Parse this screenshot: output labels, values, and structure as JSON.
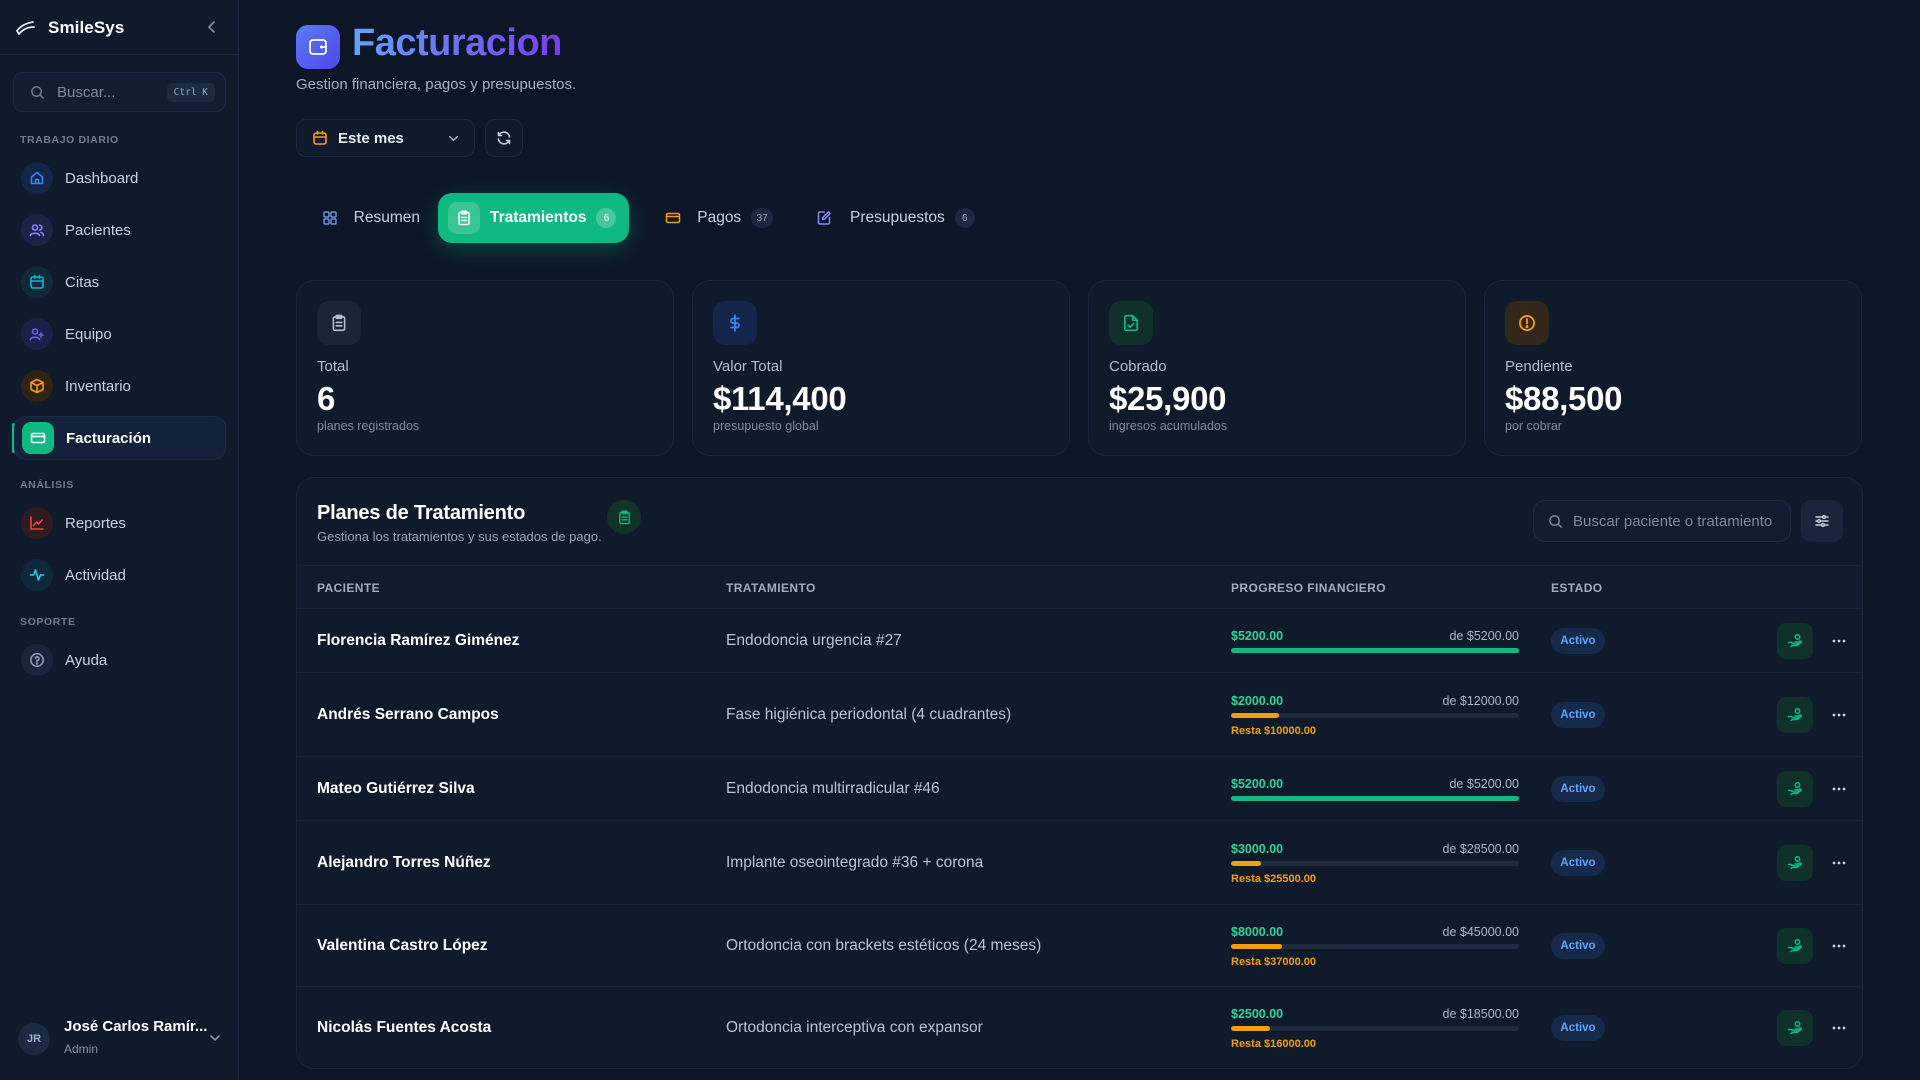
{
  "app": {
    "name": "SmileSys"
  },
  "sidebar": {
    "search_placeholder": "Buscar...",
    "search_shortcut": "Ctrl K",
    "sections": {
      "daily": "TRABAJO DIARIO",
      "analysis": "ANÁLISIS",
      "support": "SOPORTE"
    },
    "items": [
      {
        "label": "Dashboard",
        "icon": "home-icon",
        "color": "#3b82f6"
      },
      {
        "label": "Pacientes",
        "icon": "users-icon",
        "color": "#818cf8"
      },
      {
        "label": "Citas",
        "icon": "calendar-icon",
        "color": "#06b6d4"
      },
      {
        "label": "Equipo",
        "icon": "team-icon",
        "color": "#6366f1"
      },
      {
        "label": "Inventario",
        "icon": "box-icon",
        "color": "#f59e0b"
      },
      {
        "label": "Facturación",
        "icon": "billing-icon",
        "color": "#10b981",
        "active": true
      },
      {
        "label": "Reportes",
        "icon": "chart-icon",
        "color": "#ef4444"
      },
      {
        "label": "Actividad",
        "icon": "activity-icon",
        "color": "#22d3ee"
      },
      {
        "label": "Ayuda",
        "icon": "help-icon",
        "color": "#94a3b8"
      }
    ],
    "user": {
      "initials": "JR",
      "name": "José Carlos Ramír...",
      "role": "Admin"
    }
  },
  "header": {
    "title": "Facturacion",
    "subtitle": "Gestion financiera, pagos y presupuestos.",
    "period": "Este mes"
  },
  "tabs": [
    {
      "label": "Resumen",
      "badge": null,
      "icon": "grid-icon"
    },
    {
      "label": "Tratamientos",
      "badge": "6",
      "icon": "clipboard-icon",
      "active": true
    },
    {
      "label": "Pagos",
      "badge": "37",
      "icon": "card-icon"
    },
    {
      "label": "Presupuestos",
      "badge": "6",
      "icon": "edit-doc-icon"
    }
  ],
  "stats": [
    {
      "label": "Total",
      "value": "6",
      "help": "planes registrados",
      "icon": "clipboard-icon",
      "color": "#94a3b8"
    },
    {
      "label": "Valor Total",
      "value": "$114,400",
      "help": "presupuesto global",
      "icon": "dollar-icon",
      "color": "#3b82f6"
    },
    {
      "label": "Cobrado",
      "value": "$25,900",
      "help": "ingresos acumulados",
      "icon": "file-check-icon",
      "color": "#10b981"
    },
    {
      "label": "Pendiente",
      "value": "$88,500",
      "help": "por cobrar",
      "icon": "alert-icon",
      "color": "#f59e0b"
    }
  ],
  "plans": {
    "title": "Planes de Tratamiento",
    "subtitle": "Gestiona los tratamientos y sus estados de pago.",
    "search_placeholder": "Buscar paciente o tratamiento",
    "columns": {
      "patient": "PACIENTE",
      "treatment": "TRATAMIENTO",
      "progress": "PROGRESO FINANCIERO",
      "status": "ESTADO"
    },
    "rows": [
      {
        "patient": "Florencia Ramírez Giménez",
        "treatment": "Endodoncia urgencia #27",
        "paid": "$5200.00",
        "total": "de $5200.00",
        "rest": "",
        "progress": 1.0,
        "status": "Activo"
      },
      {
        "patient": "Andrés Serrano Campos",
        "treatment": "Fase higiénica periodontal (4 cuadrantes)",
        "paid": "$2000.00",
        "total": "de $12000.00",
        "rest": "Resta $10000.00",
        "progress": 0.1667,
        "status": "Activo"
      },
      {
        "patient": "Mateo Gutiérrez Silva",
        "treatment": "Endodoncia multirradicular #46",
        "paid": "$5200.00",
        "total": "de $5200.00",
        "rest": "",
        "progress": 1.0,
        "status": "Activo"
      },
      {
        "patient": "Alejandro Torres Núñez",
        "treatment": "Implante oseointegrado #36 + corona",
        "paid": "$3000.00",
        "total": "de $28500.00",
        "rest": "Resta $25500.00",
        "progress": 0.1053,
        "status": "Activo"
      },
      {
        "patient": "Valentina Castro López",
        "treatment": "Ortodoncia con brackets estéticos (24 meses)",
        "paid": "$8000.00",
        "total": "de $45000.00",
        "rest": "Resta $37000.00",
        "progress": 0.1778,
        "status": "Activo"
      },
      {
        "patient": "Nicolás Fuentes Acosta",
        "treatment": "Ortodoncia interceptiva con expansor",
        "paid": "$2500.00",
        "total": "de $18500.00",
        "rest": "Resta $16000.00",
        "progress": 0.1351,
        "status": "Activo"
      }
    ]
  },
  "colors": {
    "accent": "#10b981",
    "brand_gradient_start": "#60a5fa",
    "brand_gradient_end": "#7c3aed",
    "full_progress": "#10b981",
    "partial_progress": "#f59e0b",
    "status_active": "#60a5fa"
  }
}
